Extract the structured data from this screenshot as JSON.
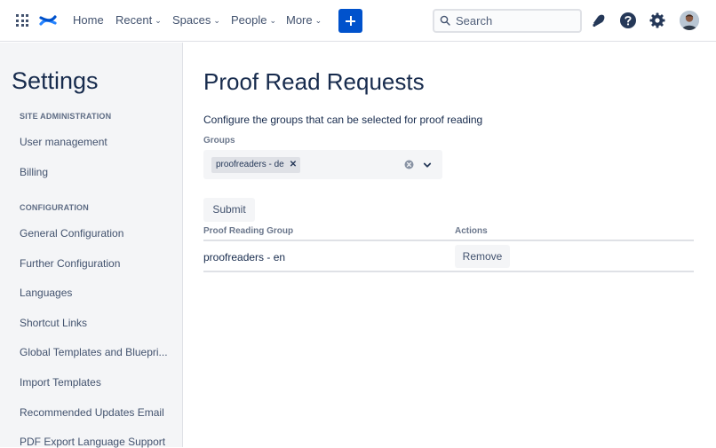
{
  "header": {
    "nav": [
      "Home",
      "Recent",
      "Spaces",
      "People",
      "More"
    ],
    "search_placeholder": "Search",
    "icons": [
      "app-switcher-icon",
      "confluence-logo-icon",
      "plus-icon",
      "search-icon",
      "notifications-icon",
      "help-icon",
      "settings-icon"
    ],
    "accent_color": "#0052CC"
  },
  "sidebar": {
    "title": "Settings",
    "sections": [
      {
        "heading": "SITE ADMINISTRATION",
        "items": [
          "User management",
          "Billing"
        ]
      },
      {
        "heading": "CONFIGURATION",
        "items": [
          "General Configuration",
          "Further Configuration",
          "Languages",
          "Shortcut Links",
          "Global Templates and Bluepri...",
          "Import Templates",
          "Recommended Updates Email",
          "PDF Export Language Support"
        ]
      }
    ]
  },
  "main": {
    "title": "Proof Read Requests",
    "description": "Configure the groups that can be selected for proof reading",
    "groups_label": "Groups",
    "selected_groups": [
      "proofreaders - de"
    ],
    "submit_label": "Submit",
    "table": {
      "columns": [
        "Proof Reading Group",
        "Actions"
      ],
      "rows": [
        {
          "group": "proofreaders - en",
          "action": "Remove"
        }
      ]
    }
  }
}
